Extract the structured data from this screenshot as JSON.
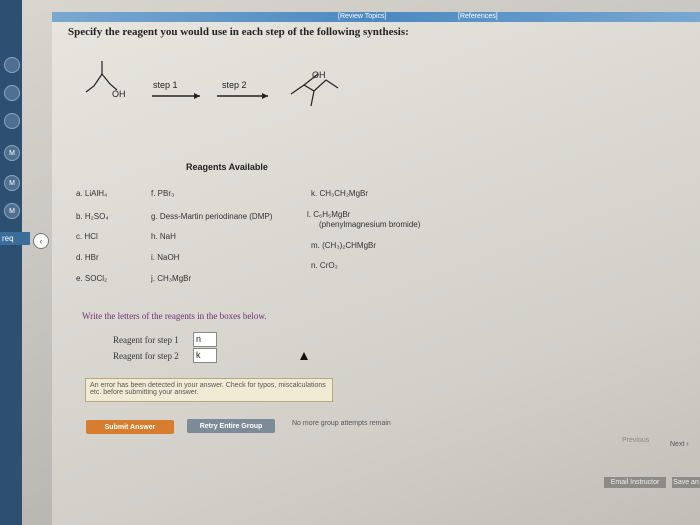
{
  "links": {
    "review_topics": "[Review Topics]",
    "references": "[References]"
  },
  "sidebar": {
    "dots": [
      "",
      "",
      "",
      "M",
      "M",
      "M"
    ],
    "tab": "req"
  },
  "question": {
    "title": "Specify the reagent you would use in each step of the following synthesis:",
    "oh_left": "OH",
    "oh_right": "OH",
    "step1": "step 1",
    "step2": "step 2"
  },
  "reagents": {
    "title": "Reagents Available",
    "items": [
      "a. LiAlH₄",
      "b. H₂SO₄",
      "c. HCl",
      "d. HBr",
      "e. SOCl₂",
      "f. PBr₃",
      "g. Dess-Martin periodinane (DMP)",
      "h. NaH",
      "i. NaOH",
      "j. CH₃MgBr",
      "k. CH₃CH₂MgBr",
      "l. C₆H₅MgBr",
      "(phenylmagnesium bromide)",
      "m. (CH₃)₂CHMgBr",
      "n. CrO₃"
    ]
  },
  "answers": {
    "instruction": "Write the letters of the reagents in the boxes below.",
    "step1_label": "Reagent for step 1",
    "step1_value": "n",
    "step2_label": "Reagent for step 2",
    "step2_value": "k"
  },
  "feedback": {
    "error": "An error has been detected in your answer. Check for typos, miscalculations etc. before submitting your answer."
  },
  "actions": {
    "submit": "Submit Answer",
    "retry": "Retry Entire Group",
    "note": "No more group attempts remain",
    "previous": "Previous",
    "next": "Next",
    "email": "Email Instructor",
    "save": "Save an"
  }
}
